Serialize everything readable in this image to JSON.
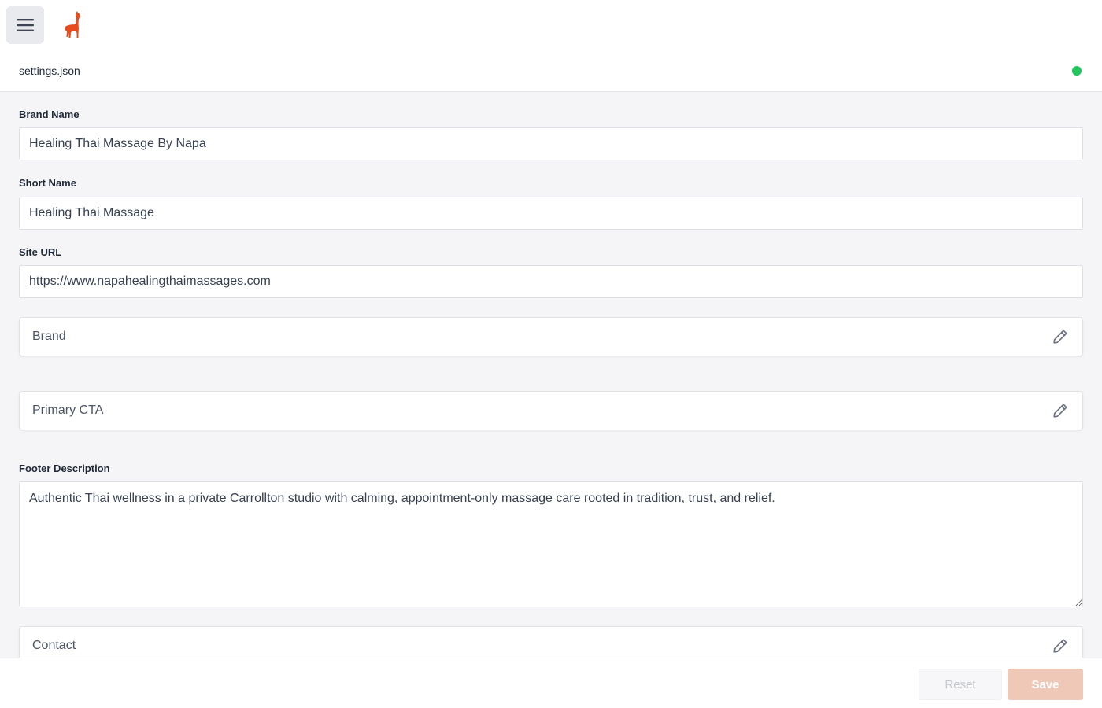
{
  "header": {
    "menu_icon": "hamburger-icon",
    "logo_icon": "llama-logo-icon",
    "brand_color": "#e84c1c"
  },
  "file": {
    "name": "settings.json",
    "status_color": "#22c55e"
  },
  "form": {
    "brand_name": {
      "label": "Brand Name",
      "value": "Healing Thai Massage By Napa"
    },
    "short_name": {
      "label": "Short Name",
      "value": "Healing Thai Massage"
    },
    "site_url": {
      "label": "Site URL",
      "value": "https://www.napahealingthaimassages.com"
    },
    "brand_panel": {
      "label": "Brand",
      "icon": "pencil-icon"
    },
    "primary_cta_panel": {
      "label": "Primary CTA",
      "icon": "pencil-icon"
    },
    "footer_description": {
      "label": "Footer Description",
      "value": "Authentic Thai wellness in a private Carrollton studio with calming, appointment-only massage care rooted in tradition, trust, and relief."
    },
    "contact_panel": {
      "label": "Contact",
      "icon": "pencil-icon"
    }
  },
  "actions": {
    "reset_label": "Reset",
    "save_label": "Save",
    "save_color": "#efc8b8"
  }
}
